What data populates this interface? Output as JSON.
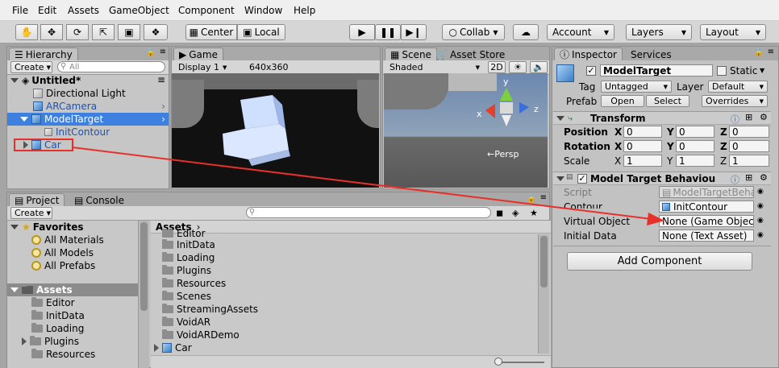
{
  "menu": [
    "File",
    "Edit",
    "Assets",
    "GameObject",
    "Component",
    "Window",
    "Help"
  ],
  "toolbar": {
    "pivot": "Center",
    "space": "Local",
    "collab": "Collab",
    "account": "Account",
    "layers": "Layers",
    "layout": "Layout"
  },
  "hierarchy": {
    "tab": "Hierarchy",
    "create": "Create",
    "search_placeholder": "All",
    "scene": "Untitled*",
    "items": [
      "Directional Light",
      "ARCamera",
      "ModelTarget",
      "InitContour",
      "Car"
    ]
  },
  "game": {
    "tab": "Game",
    "display": "Display 1",
    "resolution": "640x360"
  },
  "scene": {
    "tab": "Scene",
    "asset_store_tab": "Asset Store",
    "mode": "Shaded",
    "toggle_2d": "2D",
    "persp": "Persp",
    "axis_x": "x",
    "axis_y": "y",
    "axis_z": "z"
  },
  "project": {
    "tab": "Project",
    "console_tab": "Console",
    "create": "Create",
    "favorites_label": "Favorites",
    "favorites": [
      "All Materials",
      "All Models",
      "All Prefabs"
    ],
    "assets_label": "Assets",
    "asset_tree": [
      "Editor",
      "InitData",
      "Loading",
      "Plugins",
      "Resources"
    ],
    "breadcrumb": "Assets",
    "files": [
      "Editor",
      "InitData",
      "Loading",
      "Plugins",
      "Resources",
      "Scenes",
      "StreamingAssets",
      "VoidAR",
      "VoidARDemo",
      "Car"
    ]
  },
  "inspector": {
    "tab": "Inspector",
    "services_tab": "Services",
    "object_name": "ModelTarget",
    "static_label": "Static",
    "tag_label": "Tag",
    "tag_value": "Untagged",
    "layer_label": "Layer",
    "layer_value": "Default",
    "prefab_label": "Prefab",
    "prefab_open": "Open",
    "prefab_select": "Select",
    "prefab_overrides": "Overrides",
    "transform": {
      "title": "Transform",
      "position_label": "Position",
      "rotation_label": "Rotation",
      "scale_label": "Scale",
      "x": "X",
      "y": "Y",
      "z": "Z",
      "position": [
        "0",
        "0",
        "0"
      ],
      "rotation": [
        "0",
        "0",
        "0"
      ],
      "scale": [
        "1",
        "1",
        "1"
      ]
    },
    "component": {
      "title": "Model Target Behaviou",
      "script_label": "Script",
      "script_value": "ModelTargetBeha",
      "contour_label": "Contour",
      "contour_value": "InitContour",
      "virtual_label": "Virtual Object",
      "virtual_value": "None (Game Object",
      "initdata_label": "Initial Data",
      "initdata_value": "None (Text Asset)"
    },
    "add_component": "Add Component"
  },
  "colors": {
    "annotation": "#e8302a",
    "selection": "#3d80df"
  }
}
